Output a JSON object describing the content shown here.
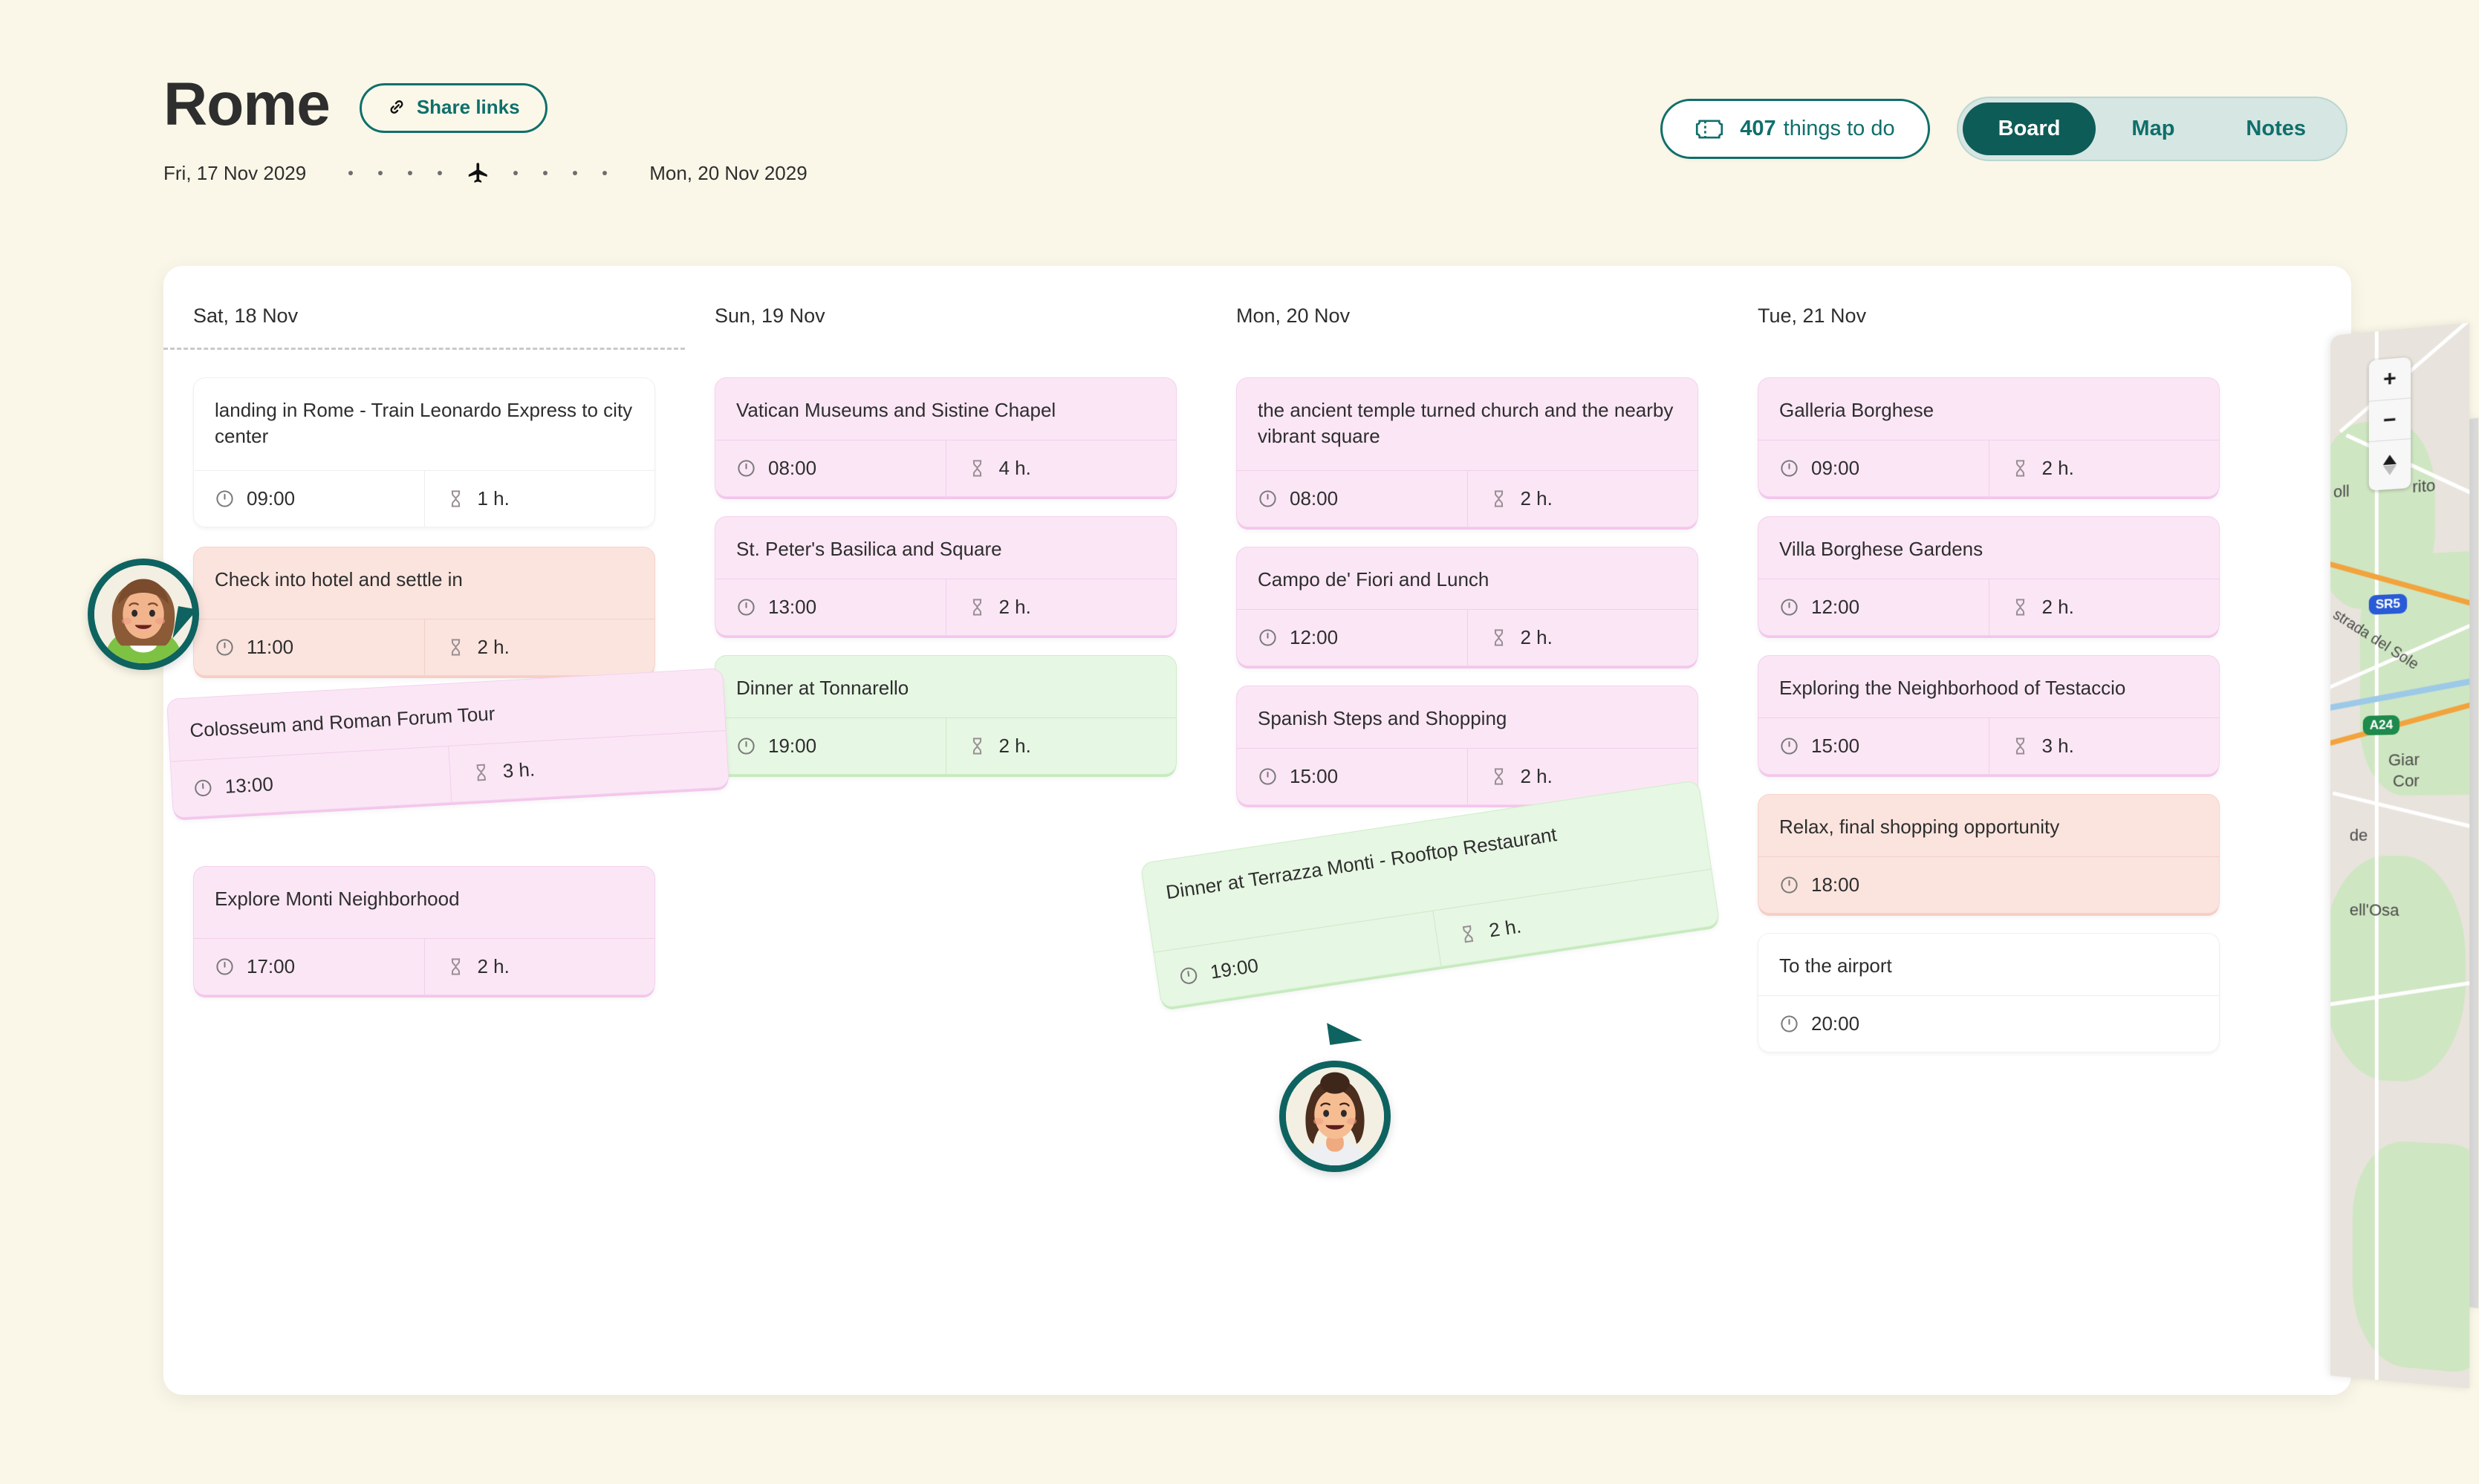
{
  "header": {
    "city": "Rome",
    "share_label": "Share links",
    "share_icon": "link-icon",
    "start_date": "Fri, 17 Nov 2029",
    "end_date": "Mon, 20 Nov 2029",
    "plane_icon": "airplane-icon",
    "things_count": "407",
    "things_label": "things to do",
    "things_icon": "ticket-icon",
    "views": [
      {
        "label": "Board",
        "active": true
      },
      {
        "label": "Map",
        "active": false
      },
      {
        "label": "Notes",
        "active": false
      }
    ]
  },
  "board": {
    "columns": [
      {
        "day": "Sat, 18 Nov",
        "cards": [
          {
            "title": "landing in Rome - Train Leonardo Express to city center",
            "time": "09:00",
            "duration": "1 h.",
            "color": "white"
          },
          {
            "title": "Check into hotel and settle in",
            "time": "11:00",
            "duration": "2 h.",
            "color": "peach"
          },
          {
            "title": "Explore Monti Neighborhood",
            "time": "17:00",
            "duration": "2 h.",
            "color": "pink"
          }
        ]
      },
      {
        "day": "Sun, 19 Nov",
        "cards": [
          {
            "title": "Vatican Museums and Sistine Chapel",
            "time": "08:00",
            "duration": "4 h.",
            "color": "pink"
          },
          {
            "title": "St. Peter's Basilica and Square",
            "time": "13:00",
            "duration": "2 h.",
            "color": "pink"
          },
          {
            "title": "Dinner at Tonnarello",
            "time": "19:00",
            "duration": "2 h.",
            "color": "green"
          }
        ]
      },
      {
        "day": "Mon, 20 Nov",
        "cards": [
          {
            "title": "the ancient temple turned church and the nearby vibrant square",
            "time": "08:00",
            "duration": "2 h.",
            "color": "pink"
          },
          {
            "title": "Campo de' Fiori and Lunch",
            "time": "12:00",
            "duration": "2 h.",
            "color": "pink"
          },
          {
            "title": "Spanish Steps and Shopping",
            "time": "15:00",
            "duration": "2 h.",
            "color": "pink"
          }
        ]
      },
      {
        "day": "Tue, 21 Nov",
        "cards": [
          {
            "title": "Galleria Borghese",
            "time": "09:00",
            "duration": "2 h.",
            "color": "pink"
          },
          {
            "title": "Villa Borghese Gardens",
            "time": "12:00",
            "duration": "2 h.",
            "color": "pink"
          },
          {
            "title": "Exploring the Neighborhood of Testaccio",
            "time": "15:00",
            "duration": "3 h.",
            "color": "pink"
          },
          {
            "title": "Relax, final shopping opportunity",
            "time": "18:00",
            "duration": "",
            "color": "peach"
          },
          {
            "title": "To the airport",
            "time": "20:00",
            "duration": "",
            "color": "white"
          }
        ]
      }
    ],
    "dragged": [
      {
        "title": "Colosseum and Roman Forum Tour",
        "time": "13:00",
        "duration": "3 h.",
        "color": "pink"
      },
      {
        "title": "Dinner at Terrazza Monti - Rooftop Restaurant",
        "time": "19:00",
        "duration": "2 h.",
        "color": "green"
      }
    ]
  },
  "collaborators": [
    {
      "name": "collaborator-avatar-1",
      "shirt_color": "#7DC242",
      "hair_color": "#8B5A36",
      "skin_color": "#F2B48C"
    },
    {
      "name": "collaborator-avatar-2",
      "shirt_color": "#EDEFF3",
      "hair_color": "#4B2E1E",
      "skin_color": "#F6BD93"
    }
  ],
  "map": {
    "zoom_in_label": "+",
    "zoom_out_label": "−",
    "labels": [
      "oll",
      "rito",
      "SR5",
      "strada del Sole",
      "A24",
      "Giar",
      "Cor",
      "de",
      "ell'Osa"
    ],
    "highway_shields": [
      {
        "text": "SR5",
        "color": "#2A5BD7"
      },
      {
        "text": "A24",
        "color": "#1E8A4C"
      }
    ]
  },
  "colors": {
    "background": "#FAF7E8",
    "accent": "#0F6F6B",
    "accent_dark": "#0E5C58",
    "card_pink": "#FBE6F6",
    "card_peach": "#FBE4DE",
    "card_green": "#E6F7E3",
    "card_white": "#FFFFFF"
  }
}
